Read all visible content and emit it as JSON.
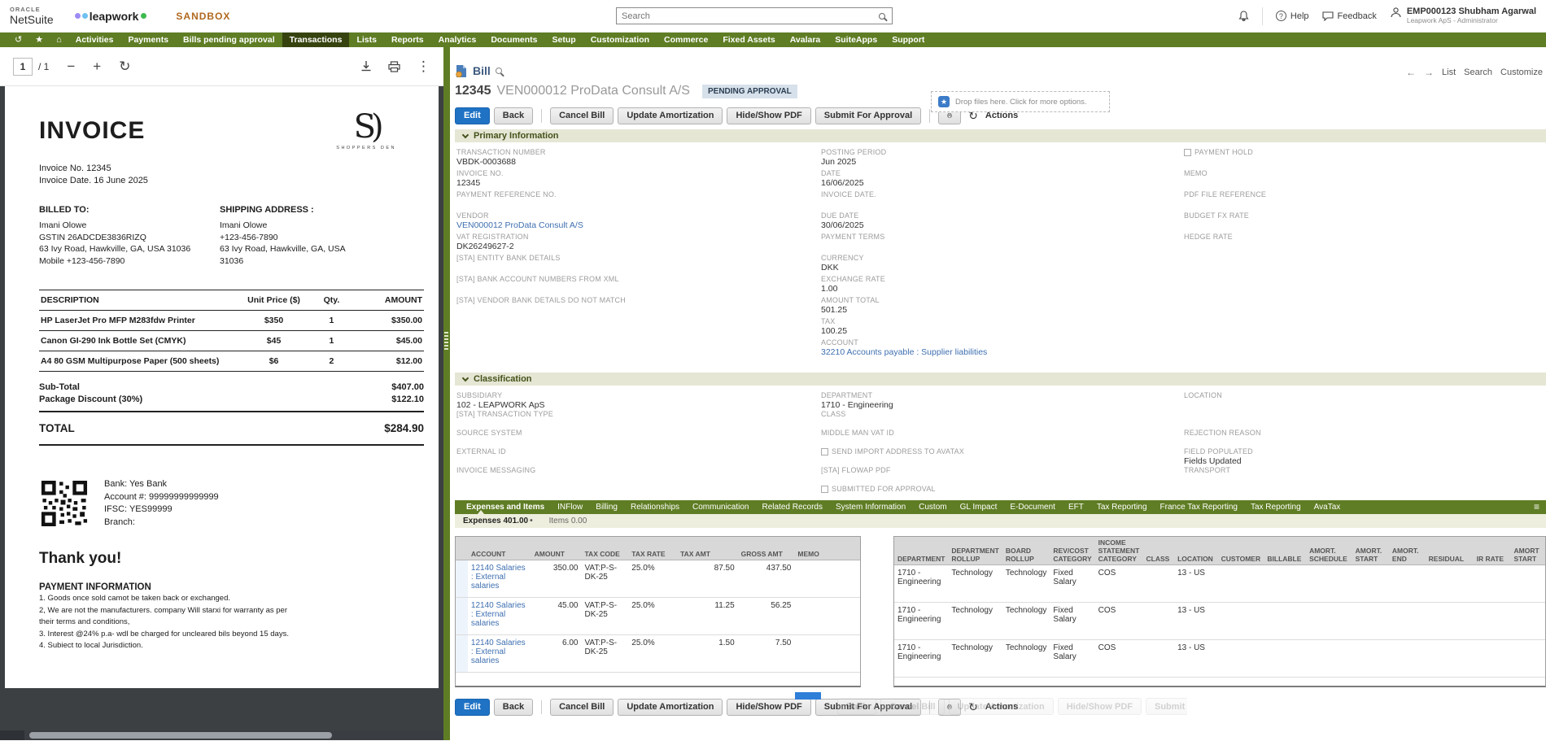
{
  "icons": {
    "history": "↺",
    "star": "★",
    "home": "⌂",
    "kebab": "⋮",
    "hamburger": "≡",
    "back_arrow": "←",
    "forward_arrow": "→",
    "minus": "−",
    "plus": "+",
    "rotate": "↻",
    "refresh": "↻",
    "help_glyph": "?",
    "dot": "•",
    "dz_star": "★"
  },
  "header": {
    "oracle": "ORACLE",
    "netsuite": "NetSuite",
    "company": "leapwork",
    "env": "SANDBOX",
    "search_placeholder": "Search",
    "help": "Help",
    "feedback": "Feedback",
    "user_name": "EMP000123 Shubham Agarwal",
    "user_role": "Leapwork ApS - Administrator"
  },
  "nav": {
    "items": [
      {
        "label": "Activities"
      },
      {
        "label": "Payments"
      },
      {
        "label": "Bills pending approval"
      },
      {
        "label": "Transactions",
        "cls": "sel"
      },
      {
        "label": "Lists"
      },
      {
        "label": "Reports"
      },
      {
        "label": "Analytics"
      },
      {
        "label": "Documents"
      },
      {
        "label": "Setup"
      },
      {
        "label": "Customization"
      },
      {
        "label": "Commerce"
      },
      {
        "label": "Fixed Assets"
      },
      {
        "label": "Avalara"
      },
      {
        "label": "SuiteApps"
      },
      {
        "label": "Support"
      }
    ]
  },
  "pdf": {
    "page": "1",
    "page_total": "/ 1"
  },
  "invoice": {
    "title": "INVOICE",
    "logo_mark": "S)",
    "logo_name": "SHOPPERS DEN",
    "number_line": "Invoice No. 12345",
    "date_line": "Invoice Date. 16 June 2025",
    "billed_label": "BILLED TO:",
    "billed_lines": [
      "Imani Olowe",
      "GSTIN 26ADCDE3836RIZQ",
      "63 Ivy Road, Hawkville, GA, USA 31036",
      "Mobile +123-456-7890"
    ],
    "shipping_label": "SHIPPING ADDRESS :",
    "shipping_lines": [
      "Imani Olowe",
      "+123-456-7890",
      "63 Ivy Road, Hawkville, GA, USA",
      "31036"
    ],
    "cols": {
      "description": "DESCRIPTION",
      "unit_price": "Unit Price ($)",
      "qty": "Qty.",
      "amount": "AMOUNT"
    },
    "rows": [
      {
        "description": "HP LaserJet Pro MFP M283fdw Printer",
        "unit_price": "$350",
        "qty": "1",
        "amount": "$350.00"
      },
      {
        "description": "Canon GI-290 Ink Bottle Set (CMYK)",
        "unit_price": "$45",
        "qty": "1",
        "amount": "$45.00"
      },
      {
        "description": "A4 80 GSM Multipurpose Paper (500 sheets)",
        "unit_price": "$6",
        "qty": "2",
        "amount": "$12.00"
      }
    ],
    "subtotal_label": "Sub-Total",
    "subtotal": "$407.00",
    "discount_label": "Package Discount (30%)",
    "discount": "$122.10",
    "total_label": "TOTAL",
    "total": "$284.90",
    "bank_lines": [
      "Bank: Yes Bank",
      "Account #: 99999999999999",
      "IFSC: YES99999",
      "Branch:"
    ],
    "thanks": "Thank you!",
    "payinfo_title": "PAYMENT INFORMATION",
    "terms": [
      "1. Goods once sold camot be taken back or exchanged.",
      "2, We are not the manufacturers. company Will starxi for warranty as per",
      "their terms and conditions,",
      "3. Interest @24% p.a- wdl be charged for uncleared bils beyond 15 days.",
      "4. Subiect to local Jurisdiction."
    ]
  },
  "bill": {
    "record_type": "Bill",
    "id": "12345",
    "vendor_name": "VEN000012 ProData Consult A/S",
    "status": "PENDING APPROVAL",
    "links": [
      "List",
      "Search",
      "Customize"
    ],
    "btn_edit": "Edit",
    "btn_back": "Back",
    "btn_group": [
      "Cancel Bill",
      "Update Amortization",
      "Hide/Show PDF",
      "Submit For Approval"
    ],
    "actions": "Actions",
    "dropzone": "Drop files here. Click for more options.",
    "ghost_buttons": [
      "Back",
      "Cancel Bill",
      "Update Amortization",
      "Hide/Show PDF",
      "Submit For Approval"
    ]
  },
  "primary": {
    "title": "Primary Information",
    "col1": [
      {
        "label": "TRANSACTION NUMBER",
        "value": "VBDK-0003688"
      },
      {
        "label": "INVOICE NO.",
        "value": "12345"
      },
      {
        "label": "PAYMENT REFERENCE NO.",
        "value": ""
      },
      {
        "label": "VENDOR",
        "value": "VEN000012 ProData Consult A/S",
        "cls": "link"
      },
      {
        "label": "VAT REGISTRATION",
        "value": "DK26249627-2"
      },
      {
        "label": "[STA] ENTITY BANK DETAILS",
        "value": ""
      },
      {
        "label": "[STA] BANK ACCOUNT NUMBERS FROM XML",
        "value": ""
      },
      {
        "label": "[STA] VENDOR BANK DETAILS DO NOT MATCH",
        "value": ""
      }
    ],
    "col2": [
      {
        "label": "POSTING PERIOD",
        "value": "Jun 2025"
      },
      {
        "label": "DATE",
        "value": "16/06/2025"
      },
      {
        "label": "INVOICE DATE.",
        "value": ""
      },
      {
        "label": "DUE DATE",
        "value": "30/06/2025"
      },
      {
        "label": "PAYMENT TERMS",
        "value": ""
      },
      {
        "label": "CURRENCY",
        "value": "DKK"
      },
      {
        "label": "EXCHANGE RATE",
        "value": "1.00"
      },
      {
        "label": "AMOUNT TOTAL",
        "value": "501.25"
      },
      {
        "label": "TAX",
        "value": "100.25"
      },
      {
        "label": "ACCOUNT",
        "value": "32210 Accounts payable : Supplier liabilities",
        "cls": "link"
      }
    ],
    "col3": [
      {
        "label": "PAYMENT HOLD",
        "cb": true
      },
      {
        "label": "MEMO",
        "value": ""
      },
      {
        "label": "PDF FILE REFERENCE",
        "value": ""
      },
      {
        "label": "BUDGET FX RATE",
        "value": ""
      },
      {
        "label": "HEDGE RATE",
        "value": ""
      }
    ]
  },
  "classification": {
    "title": "Classification",
    "col1": [
      {
        "label": "SUBSIDIARY",
        "value": "102 - LEAPWORK ApS"
      },
      {
        "label": "[STA] TRANSACTION TYPE",
        "value": ""
      },
      {
        "label": "SOURCE SYSTEM",
        "value": ""
      },
      {
        "label": "EXTERNAL ID",
        "value": ""
      },
      {
        "label": "INVOICE MESSAGING",
        "value": ""
      }
    ],
    "col2": [
      {
        "label": "DEPARTMENT",
        "value": "1710 - Engineering"
      },
      {
        "label": "CLASS",
        "value": ""
      },
      {
        "label": "MIDDLE MAN VAT ID",
        "value": ""
      },
      {
        "label": "SEND IMPORT ADDRESS TO AVATAX",
        "cb": true
      },
      {
        "label": "[STA] FLOWAP PDF",
        "value": ""
      },
      {
        "label": "SUBMITTED FOR APPROVAL",
        "cb": true
      }
    ],
    "col3": [
      {
        "label": "LOCATION",
        "value": ""
      },
      {
        "label": "",
        "value": ""
      },
      {
        "label": "REJECTION REASON",
        "value": ""
      },
      {
        "label": "FIELD POPULATED",
        "value": "Fields Updated"
      },
      {
        "label": "TRANSPORT",
        "value": ""
      }
    ]
  },
  "tabs": {
    "items": [
      {
        "label": "Expenses and Items",
        "cls": "sel"
      },
      {
        "label": "INFlow"
      },
      {
        "label": "Billing"
      },
      {
        "label": "Relationships"
      },
      {
        "label": "Communication"
      },
      {
        "label": "Related Records"
      },
      {
        "label": "System Information"
      },
      {
        "label": "Custom"
      },
      {
        "label": "GL Impact"
      },
      {
        "label": "E-Document"
      },
      {
        "label": "EFT"
      },
      {
        "label": "Tax Reporting"
      },
      {
        "label": "France Tax Reporting"
      },
      {
        "label": "Tax Reporting"
      },
      {
        "label": "AvaTax"
      }
    ],
    "expenses_label": "Expenses",
    "expenses_amount": "401.00",
    "items_label": "Items",
    "items_amount": "0.00"
  },
  "expenses": {
    "headers_left": [
      "",
      "ACCOUNT",
      "AMOUNT",
      "TAX CODE",
      "TAX RATE",
      "TAX AMT",
      "GROSS AMT",
      "MEMO"
    ],
    "headers_right": [
      "DEPARTMENT",
      "DEPARTMENT ROLLUP",
      "BOARD ROLLUP",
      "REV/COST CATEGORY",
      "INCOME STATEMENT CATEGORY",
      "CLASS",
      "LOCATION",
      "CUSTOMER",
      "BILLABLE",
      "AMORT. SCHEDULE",
      "AMORT. START",
      "AMORT. END",
      "RESIDUAL",
      "IR RATE",
      "AMORT START"
    ],
    "rows": [
      {
        "account": "12140 Salaries : External salaries",
        "amount": "350.00",
        "tax_code": "VAT:P-S-DK-25",
        "tax_rate": "25.0%",
        "tax_amt": "87.50",
        "gross_amt": "437.50",
        "memo": "",
        "department": "1710 - Engineering",
        "dept_rollup": "Technology",
        "board_rollup": "Technology",
        "revcost": "Fixed Salary",
        "income_stmt": "COS",
        "class": "",
        "location": "13 - US",
        "customer": "",
        "billable": "",
        "amort_schedule": "",
        "amort_start": "",
        "amort_end": "",
        "residual": "",
        "ir_rate": "",
        "amort_start2": ""
      },
      {
        "account": "12140 Salaries : External salaries",
        "amount": "45.00",
        "tax_code": "VAT:P-S-DK-25",
        "tax_rate": "25.0%",
        "tax_amt": "11.25",
        "gross_amt": "56.25",
        "memo": "",
        "department": "1710 - Engineering",
        "dept_rollup": "Technology",
        "board_rollup": "Technology",
        "revcost": "Fixed Salary",
        "income_stmt": "COS",
        "class": "",
        "location": "13 - US",
        "customer": "",
        "billable": "",
        "amort_schedule": "",
        "amort_start": "",
        "amort_end": "",
        "residual": "",
        "ir_rate": "",
        "amort_start2": ""
      },
      {
        "account": "12140 Salaries : External salaries",
        "amount": "6.00",
        "tax_code": "VAT:P-S-DK-25",
        "tax_rate": "25.0%",
        "tax_amt": "1.50",
        "gross_amt": "7.50",
        "memo": "",
        "department": "1710 - Engineering",
        "dept_rollup": "Technology",
        "board_rollup": "Technology",
        "revcost": "Fixed Salary",
        "income_stmt": "COS",
        "class": "",
        "location": "13 - US",
        "customer": "",
        "billable": "",
        "amort_schedule": "",
        "amort_start": "",
        "amort_end": "",
        "residual": "",
        "ir_rate": "",
        "amort_start2": ""
      }
    ]
  }
}
